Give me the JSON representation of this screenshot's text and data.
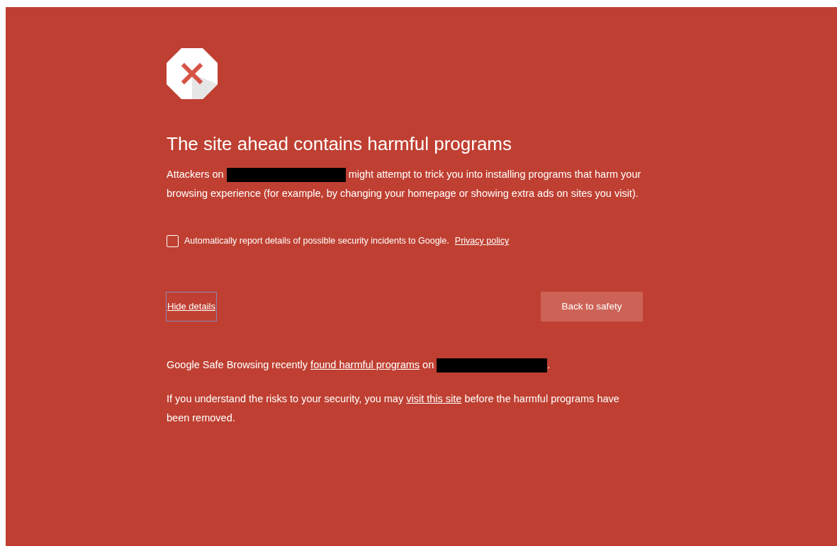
{
  "heading": "The site ahead contains harmful programs",
  "intro": [
    {
      "kind": "text",
      "text": "Attackers on "
    },
    {
      "kind": "redacted"
    },
    {
      "kind": "text",
      "text": " might attempt to trick you into installing programs that harm your browsing experience (for example, by changing your homepage or showing extra ads on sites you visit)."
    }
  ],
  "report": {
    "checked": false,
    "label": "Automatically report details of possible security incidents to Google.",
    "link": "Privacy policy"
  },
  "details_link": "Hide details",
  "back_button": "Back to safety",
  "details": [
    [
      {
        "kind": "text",
        "text": "Google Safe Browsing recently "
      },
      {
        "kind": "link",
        "text": "found harmful programs"
      },
      {
        "kind": "text",
        "text": " on "
      },
      {
        "kind": "redacted"
      },
      {
        "kind": "text",
        "text": "."
      }
    ],
    [
      {
        "kind": "text",
        "text": "If you understand the risks to your security, you may "
      },
      {
        "kind": "link",
        "text": "visit this site"
      },
      {
        "kind": "text",
        "text": " before the harmful programs have been removed."
      }
    ]
  ]
}
